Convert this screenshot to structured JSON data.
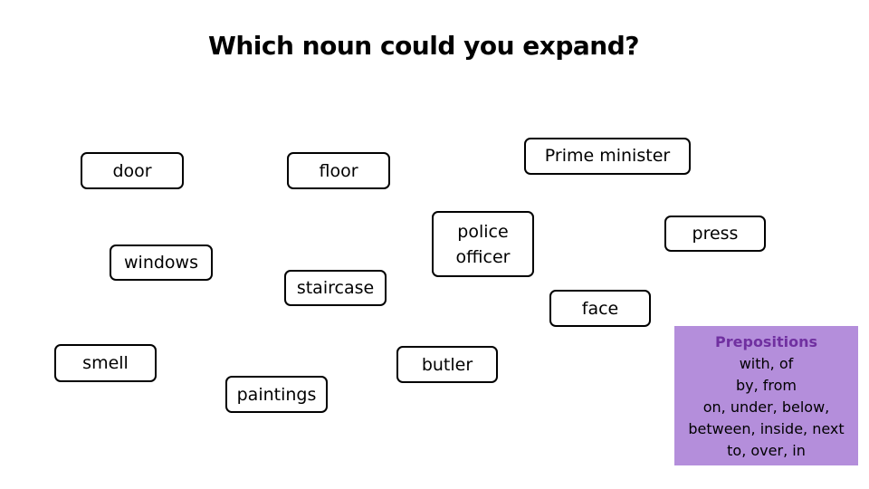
{
  "title": "Which noun could you expand?",
  "nouns": {
    "door": "door",
    "floor": "floor",
    "prime_minister": "Prime minister",
    "windows": "windows",
    "police_officer": "police\nofficer",
    "press": "press",
    "staircase": "staircase",
    "face": "face",
    "smell": "smell",
    "butler": "butler",
    "paintings": "paintings"
  },
  "prepositions": {
    "heading": "Prepositions",
    "lines": [
      "with, of",
      "by, from",
      "on, under, below,",
      "between, inside, next",
      "to, over, in"
    ],
    "colors": {
      "background": "#b48edb",
      "heading": "#7030a0"
    }
  }
}
